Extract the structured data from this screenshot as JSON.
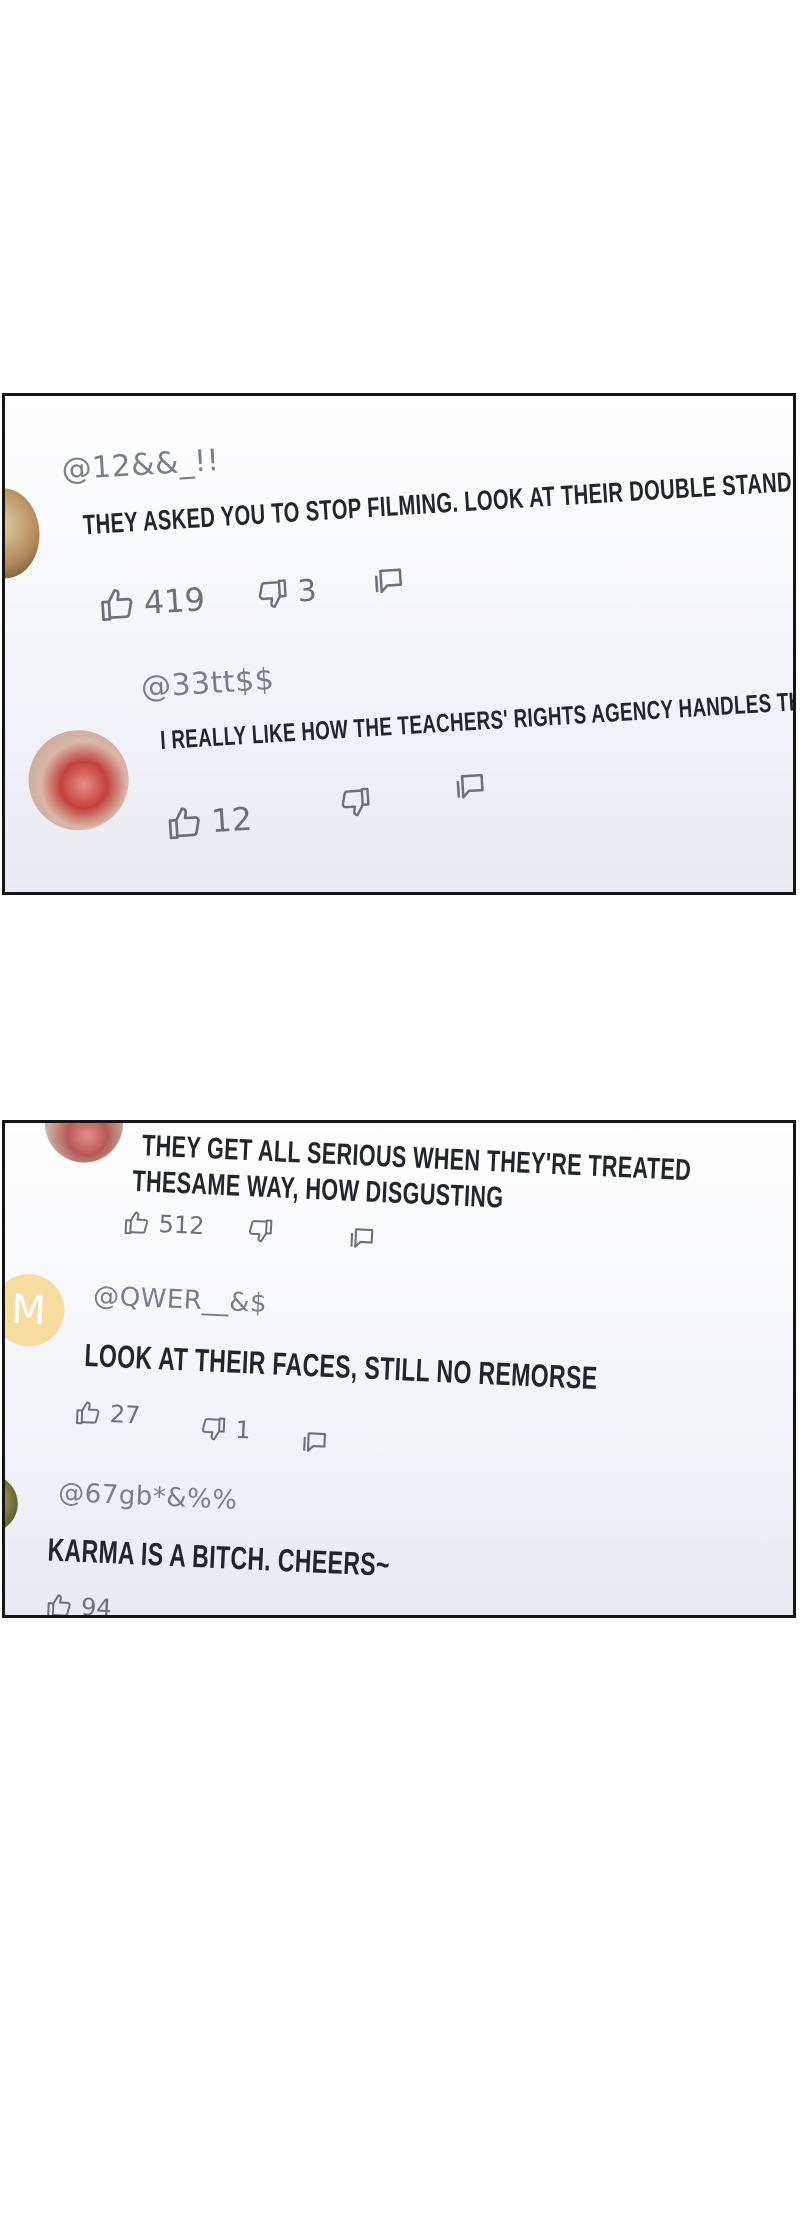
{
  "panel_1": {
    "comments": [
      {
        "handle": "@12&&_!!",
        "text": "THEY ASKED YOU TO STOP FILMING. LOOK AT THEIR DOUBLE STANDARDS~ LOLOLO",
        "likes": "419",
        "dislikes": "3",
        "avatar": "portrait-avatar"
      },
      {
        "handle": "@33tt$$",
        "text": "I REALLY LIKE HOW THE TEACHERS' RIGHTS AGENCY HANDLES THINGS~",
        "likes": "12",
        "dislikes": "",
        "avatar": "lips-avatar"
      }
    ]
  },
  "panel_2": {
    "comments": [
      {
        "handle": "",
        "text_line_1": "THEY GET ALL SERIOUS WHEN THEY'RE TREATED",
        "text_line_2": "THESAME WAY, HOW DISGUSTING",
        "likes": "512",
        "dislikes": "",
        "avatar": "lips-avatar"
      },
      {
        "handle": "@QWER__&$",
        "text": "LOOK AT THEIR FACES, STILL NO REMORSE",
        "likes": "27",
        "dislikes": "1",
        "avatar": "letter-avatar",
        "avatar_letter": "M",
        "avatar_color": "#f7dca0"
      },
      {
        "handle": "@67gb*&%%",
        "text": "KARMA IS A BITCH. CHEERS~",
        "likes": "94",
        "avatar": "portrait-avatar"
      }
    ]
  },
  "icons": {
    "like": "thumbs-up-icon",
    "dislike": "thumbs-down-icon",
    "reply": "reply-icon"
  }
}
